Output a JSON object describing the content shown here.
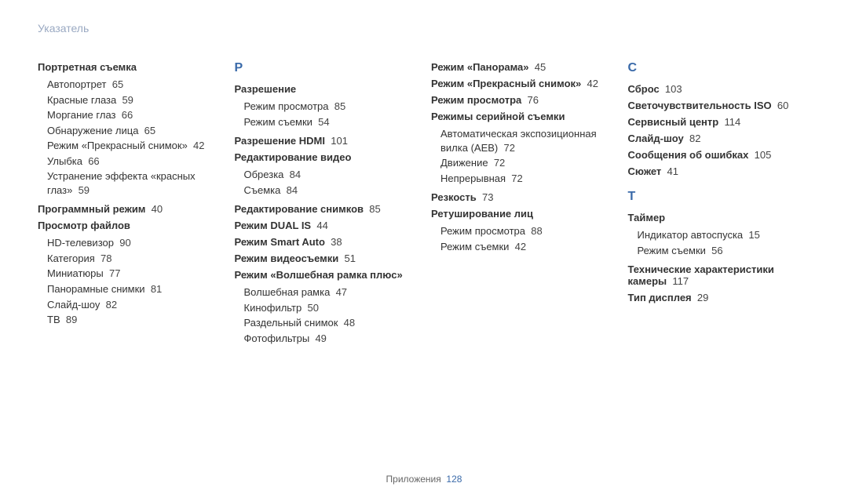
{
  "header": "Указатель",
  "footer": {
    "label": "Приложения",
    "page": "128"
  },
  "col1": {
    "g1_title": "Портретная съемка",
    "g1_sub": [
      {
        "t": "Автопортрет",
        "p": "65"
      },
      {
        "t": "Красные глаза",
        "p": "59"
      },
      {
        "t": "Моргание глаз",
        "p": "66"
      },
      {
        "t": "Обнаружение лица",
        "p": "65"
      },
      {
        "t": "Режим «Прекрасный снимок»",
        "p": "42"
      },
      {
        "t": "Улыбка",
        "p": "66"
      },
      {
        "t": "Устранение эффекта «красных глаз»",
        "p": "59"
      }
    ],
    "g2": {
      "t": "Программный режим",
      "p": "40"
    },
    "g3_title": "Просмотр файлов",
    "g3_sub": [
      {
        "t": "HD-телевизор",
        "p": "90"
      },
      {
        "t": "Категория",
        "p": "78"
      },
      {
        "t": "Миниатюры",
        "p": "77"
      },
      {
        "t": "Панорамные снимки",
        "p": "81"
      },
      {
        "t": "Слайд-шоу",
        "p": "82"
      },
      {
        "t": "ТВ",
        "p": "89"
      }
    ]
  },
  "col2": {
    "letter": "Р",
    "g1_title": "Разрешение",
    "g1_sub": [
      {
        "t": "Режим просмотра",
        "p": "85"
      },
      {
        "t": "Режим съемки",
        "p": "54"
      }
    ],
    "g2": {
      "t": "Разрешение HDMI",
      "p": "101"
    },
    "g3_title": "Редактирование видео",
    "g3_sub": [
      {
        "t": "Обрезка",
        "p": "84"
      },
      {
        "t": "Съемка",
        "p": "84"
      }
    ],
    "g4": {
      "t": "Редактирование снимков",
      "p": "85"
    },
    "g5": {
      "t": "Режим DUAL IS",
      "p": "44"
    },
    "g6": {
      "t": "Режим Smart Auto",
      "p": "38"
    },
    "g7": {
      "t": "Режим видеосъемки",
      "p": "51"
    },
    "g8_title": "Режим «Волшебная рамка плюс»",
    "g8_sub": [
      {
        "t": "Волшебная рамка",
        "p": "47"
      },
      {
        "t": "Кинофильтр",
        "p": "50"
      },
      {
        "t": "Раздельный снимок",
        "p": "48"
      },
      {
        "t": "Фотофильтры",
        "p": "49"
      }
    ]
  },
  "col3": {
    "g1": {
      "t": "Режим «Панорама»",
      "p": "45"
    },
    "g2": {
      "t": "Режим «Прекрасный снимок»",
      "p": "42"
    },
    "g3": {
      "t": "Режим просмотра",
      "p": "76"
    },
    "g4_title": "Режимы серийной съемки",
    "g4_sub": [
      {
        "t": "Автоматическая экспозиционная вилка (AEB)",
        "p": "72"
      },
      {
        "t": "Движение",
        "p": "72"
      },
      {
        "t": "Непрерывная",
        "p": "72"
      }
    ],
    "g5": {
      "t": "Резкость",
      "p": "73"
    },
    "g6_title": "Ретуширование лиц",
    "g6_sub": [
      {
        "t": "Режим просмотра",
        "p": "88"
      },
      {
        "t": "Режим съемки",
        "p": "42"
      }
    ]
  },
  "col4": {
    "letterC": "С",
    "c1": {
      "t": "Сброс",
      "p": "103"
    },
    "c2": {
      "t": "Светочувствительность ISO",
      "p": "60"
    },
    "c3": {
      "t": "Сервисный центр",
      "p": "114"
    },
    "c4": {
      "t": "Слайд-шоу",
      "p": "82"
    },
    "c5": {
      "t": "Сообщения об ошибках",
      "p": "105"
    },
    "c6": {
      "t": "Сюжет",
      "p": "41"
    },
    "letterT": "Т",
    "t1_title": "Таймер",
    "t1_sub": [
      {
        "t": "Индикатор автоспуска",
        "p": "15"
      },
      {
        "t": "Режим съемки",
        "p": "56"
      }
    ],
    "t2": {
      "t": "Технические характеристики камеры",
      "p": "117"
    },
    "t3": {
      "t": "Тип дисплея",
      "p": "29"
    }
  }
}
